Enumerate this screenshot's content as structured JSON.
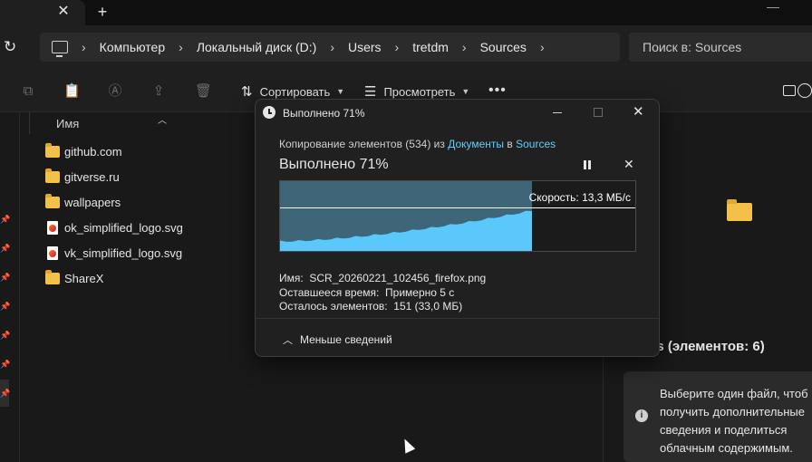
{
  "window": {
    "new_tab_label": "+",
    "close_tab_label": "✕"
  },
  "address": {
    "breadcrumb": [
      "Компьютер",
      "Локальный диск (D:)",
      "Users",
      "tretdm",
      "Sources"
    ],
    "search_placeholder": "Поиск в: Sources"
  },
  "toolbar": {
    "sort_label": "Сортировать",
    "view_label": "Просмотреть",
    "more_label": "•••"
  },
  "file_list": {
    "column_name": "Имя",
    "items": [
      {
        "name": "github.com",
        "type": "folder"
      },
      {
        "name": "gitverse.ru",
        "type": "folder"
      },
      {
        "name": "wallpapers",
        "type": "folder"
      },
      {
        "name": "ok_simplified_logo.svg",
        "type": "svg"
      },
      {
        "name": "vk_simplified_logo.svg",
        "type": "svg"
      },
      {
        "name": "ShareX",
        "type": "folder"
      }
    ]
  },
  "details_pane": {
    "title": "es (элементов: 6)",
    "info_text": "Выберите один файл, чтоб получить дополнительные сведения и поделиться облачным содержимым."
  },
  "dialog": {
    "title": "Выполнено 71%",
    "copy_prefix": "Копирование элементов (534) из ",
    "copy_source": "Документы",
    "copy_middle": " в ",
    "copy_dest": "Sources",
    "status": "Выполнено 71%",
    "progress_percent": 71,
    "speed_label": "Скорость: 13,3 МБ/с",
    "name_label": "Имя:",
    "name_value": "SCR_20260221_102456_firefox.png",
    "time_label": "Оставшееся время:",
    "time_value": "Примерно 5 с",
    "items_label": "Осталось элементов:",
    "items_value": "151 (33,0 МБ)",
    "less_details_label": "Меньше сведений"
  },
  "colors": {
    "accent": "#60cdff",
    "graph_fill": "#5ac8fa",
    "graph_done_bg": "#3e6678",
    "folder": "#f3c14a"
  }
}
